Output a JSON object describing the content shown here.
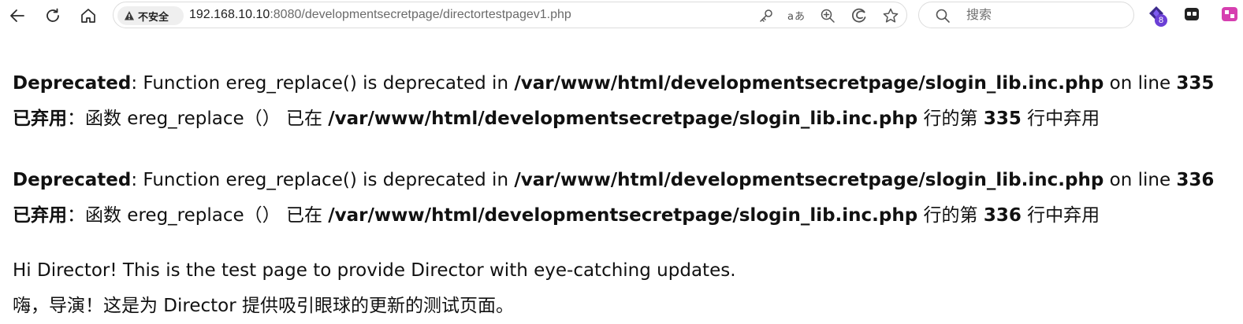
{
  "browser": {
    "security_label": "不安全",
    "url_host": "192.168.10.10",
    "url_rest": ":8080/developmentsecretpage/directortestpagev1.php",
    "search_placeholder": "搜索",
    "extension_badge": "8"
  },
  "errors": [
    {
      "en_label": "Deprecated",
      "en_text": ": Function ereg_replace() is deprecated in ",
      "en_path": "/var/www/html/developmentsecretpage/slogin_lib.inc.php",
      "en_mid": " on line ",
      "en_line": "335",
      "zh_label": "已弃用",
      "zh_text": "：函数 ereg_replace（） 已在 ",
      "zh_path": "/var/www/html/developmentsecretpage/slogin_lib.inc.php",
      "zh_mid": " 行的第 ",
      "zh_line": "335",
      "zh_end": " 行中弃用"
    },
    {
      "en_label": "Deprecated",
      "en_text": ": Function ereg_replace() is deprecated in ",
      "en_path": "/var/www/html/developmentsecretpage/slogin_lib.inc.php",
      "en_mid": " on line ",
      "en_line": "336",
      "zh_label": "已弃用",
      "zh_text": "：函数 ereg_replace（） 已在 ",
      "zh_path": "/var/www/html/developmentsecretpage/slogin_lib.inc.php",
      "zh_mid": " 行的第 ",
      "zh_line": "336",
      "zh_end": " 行中弃用"
    }
  ],
  "message": {
    "en": "Hi Director! This is the test page to provide Director with eye-catching updates.",
    "zh": "嗨，导演！这是为 Director 提供吸引眼球的更新的测试页面。"
  }
}
